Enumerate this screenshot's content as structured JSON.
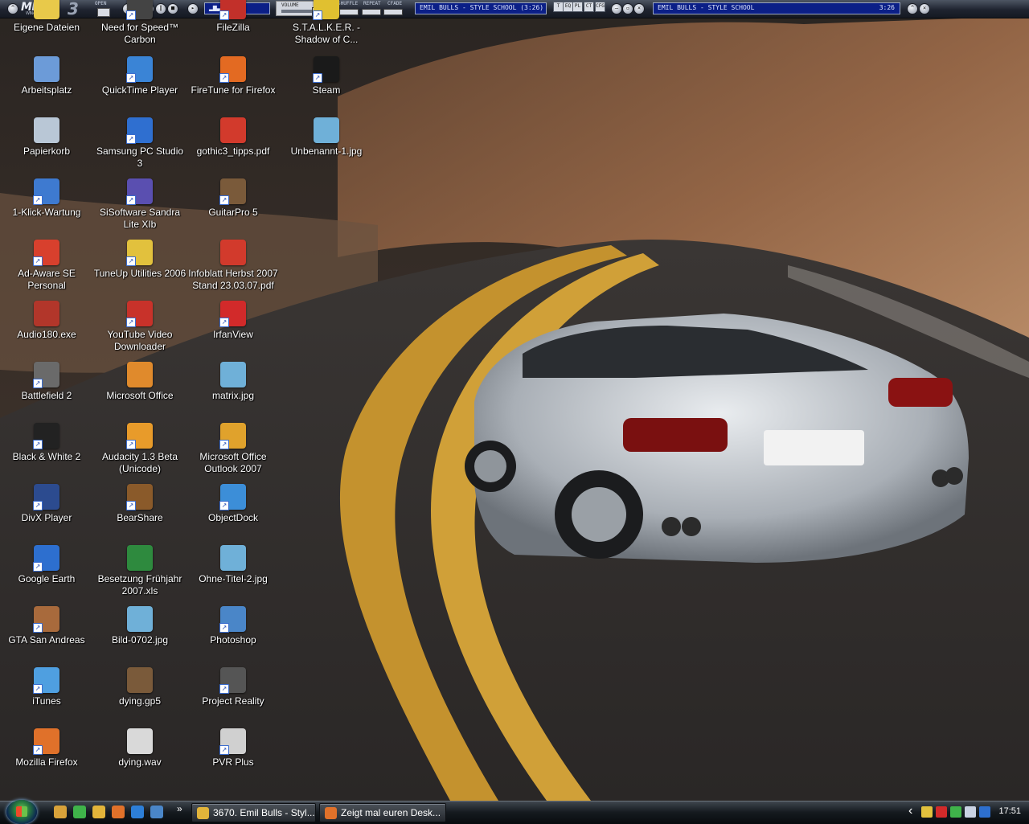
{
  "winamp": {
    "logo": "MMD",
    "logo_sub": "WINAMP-PLAYER",
    "logo_version": "3",
    "open_label": "OPEN",
    "volume_label": "VOLUME",
    "shuffle_label": "SHUFFLE",
    "repeat_label": "REPEAT",
    "cfade_label": "CFADE",
    "track_display": "EMIL BULLS - STYLE SCHOOL (3:26)",
    "mini_track": "EMIL BULLS - STYLE SCHOOL",
    "mini_time": "3:26",
    "toggle_buttons": [
      "T",
      "EQ",
      "PL",
      "CT",
      "CFG"
    ]
  },
  "desktop": {
    "icons": [
      {
        "label": "Eigene Dateien",
        "color": "#e8c94a",
        "shortcut": false
      },
      {
        "label": "Arbeitsplatz",
        "color": "#6c9bd8",
        "shortcut": false
      },
      {
        "label": "Papierkorb",
        "color": "#b9c7d6",
        "shortcut": false
      },
      {
        "label": "1-Klick-Wartung",
        "color": "#3e7ad0",
        "shortcut": true
      },
      {
        "label": "Ad-Aware SE Personal",
        "color": "#d8402d",
        "shortcut": true
      },
      {
        "label": "Audio180.exe",
        "color": "#b2362a",
        "shortcut": false
      },
      {
        "label": "Battlefield 2",
        "color": "#6a6a6a",
        "shortcut": true
      },
      {
        "label": "Black & White 2",
        "color": "#222222",
        "shortcut": true
      },
      {
        "label": "DivX Player",
        "color": "#2c4b8f",
        "shortcut": true
      },
      {
        "label": "Google Earth",
        "color": "#2d6fcf",
        "shortcut": true
      },
      {
        "label": "GTA San Andreas",
        "color": "#a86a3c",
        "shortcut": true
      },
      {
        "label": "iTunes",
        "color": "#4f9fe0",
        "shortcut": true
      },
      {
        "label": "Mozilla Firefox",
        "color": "#e0712a",
        "shortcut": true
      },
      {
        "label": "Need for Speed™ Carbon",
        "color": "#444444",
        "shortcut": true
      },
      {
        "label": "QuickTime Player",
        "color": "#3a84d6",
        "shortcut": true
      },
      {
        "label": "Samsung PC Studio 3",
        "color": "#2f6fd0",
        "shortcut": true
      },
      {
        "label": "SiSoftware Sandra Lite XIb",
        "color": "#5a4fb0",
        "shortcut": true
      },
      {
        "label": "TuneUp Utilities 2006",
        "color": "#e2c13d",
        "shortcut": true
      },
      {
        "label": "YouTube Video Downloader",
        "color": "#c8322a",
        "shortcut": true
      },
      {
        "label": "Microsoft Office",
        "color": "#e08a2c",
        "shortcut": false
      },
      {
        "label": "Audacity 1.3 Beta (Unicode)",
        "color": "#e89b2a",
        "shortcut": true
      },
      {
        "label": "BearShare",
        "color": "#8a5a2a",
        "shortcut": true
      },
      {
        "label": "Besetzung Frühjahr 2007.xls",
        "color": "#2e8a3e",
        "shortcut": false
      },
      {
        "label": "Bild-0702.jpg",
        "color": "#6fb0d8",
        "shortcut": false
      },
      {
        "label": "dying.gp5",
        "color": "#7a5a3a",
        "shortcut": false
      },
      {
        "label": "dying.wav",
        "color": "#d9d9d9",
        "shortcut": false
      },
      {
        "label": "FileZilla",
        "color": "#c2302a",
        "shortcut": true
      },
      {
        "label": "FireTune for Firefox",
        "color": "#e36a22",
        "shortcut": true
      },
      {
        "label": "gothic3_tipps.pdf",
        "color": "#d23a2c",
        "shortcut": false
      },
      {
        "label": "GuitarPro 5",
        "color": "#7a5a3a",
        "shortcut": true
      },
      {
        "label": "Infoblatt Herbst 2007 Stand 23.03.07.pdf",
        "color": "#d23a2c",
        "shortcut": false
      },
      {
        "label": "IrfanView",
        "color": "#d22a2a",
        "shortcut": true
      },
      {
        "label": "matrix.jpg",
        "color": "#6fb0d8",
        "shortcut": false
      },
      {
        "label": "Microsoft Office Outlook 2007",
        "color": "#e0a22c",
        "shortcut": true
      },
      {
        "label": "ObjectDock",
        "color": "#3c8ed8",
        "shortcut": true
      },
      {
        "label": "Ohne-Titel-2.jpg",
        "color": "#6fb0d8",
        "shortcut": false
      },
      {
        "label": "Photoshop",
        "color": "#4a86c8",
        "shortcut": true
      },
      {
        "label": "Project Reality",
        "color": "#555555",
        "shortcut": true
      },
      {
        "label": "PVR Plus",
        "color": "#d0d0d0",
        "shortcut": true
      },
      {
        "label": "S.T.A.L.K.E.R. - Shadow of C...",
        "color": "#e0c030",
        "shortcut": true
      },
      {
        "label": "Steam",
        "color": "#1a1a1a",
        "shortcut": true
      },
      {
        "label": "Unbenannt-1.jpg",
        "color": "#6fb0d8",
        "shortcut": false
      }
    ]
  },
  "taskbar": {
    "quicklaunch_icons": [
      "media-player-icon",
      "clover-icon",
      "winamp-icon",
      "firefox-icon",
      "ie-icon",
      "switch-windows-icon"
    ],
    "quicklaunch_overflow": "»",
    "tasks": [
      {
        "label": "3670. Emil Bulls - Styl...",
        "icon": "winamp-icon",
        "color": "#e2b43a"
      },
      {
        "label": "Zeigt mal euren Desk...",
        "icon": "firefox-icon",
        "color": "#e0712a"
      }
    ],
    "tray_chevron": "‹",
    "tray_icons": [
      "chat-icon",
      "antivirus-icon",
      "clover-icon",
      "network-icon",
      "volume-icon"
    ],
    "clock": "17:51"
  }
}
